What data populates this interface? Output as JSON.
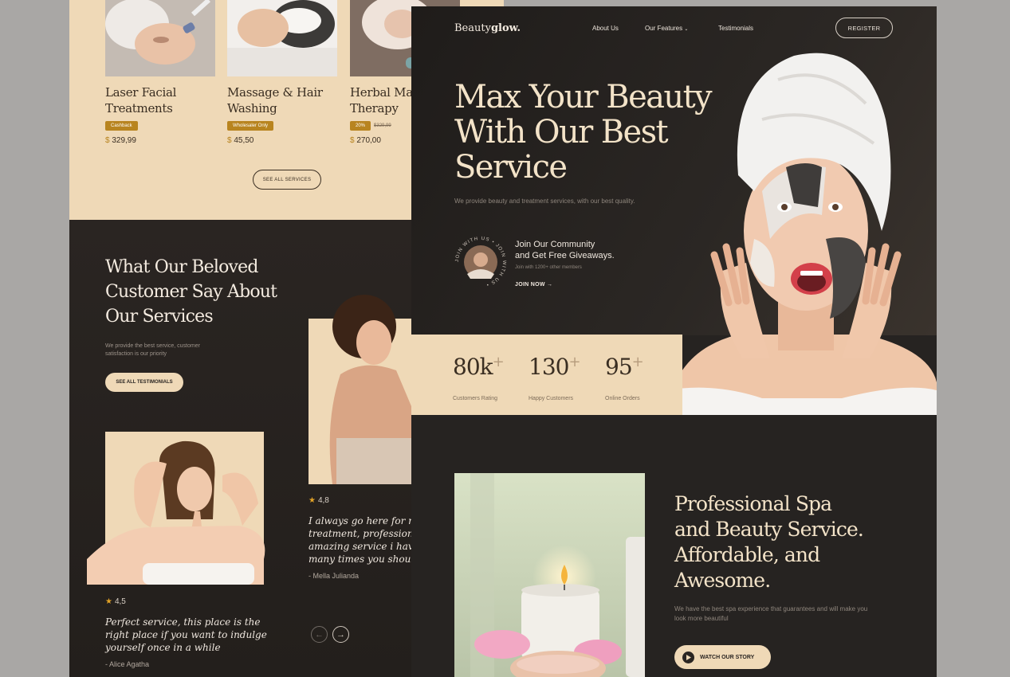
{
  "back": {
    "services": [
      {
        "title": "Laser Facial\nTreatments",
        "badge": "Cashback",
        "old_price": "",
        "currency": "$",
        "price": "329,99"
      },
      {
        "title": "Massage & Hair\nWashing",
        "badge": "Wholesaler Only",
        "old_price": "",
        "currency": "$",
        "price": "45,50"
      },
      {
        "title": "Herbal Mase\nTherapy",
        "badge": "20%",
        "old_price": "$329,99",
        "currency": "$",
        "price": "270,00"
      }
    ],
    "see_all_services": "SEE  ALL SERVICES",
    "testimonials": {
      "heading": "What Our Beloved\nCustomer Say About\nOur Services",
      "sub": "We provide the best service, customer satisfaction is our priority",
      "button": "SEE ALL TESTIMONIALS",
      "reviews": [
        {
          "rating": "4,5",
          "quote": "Perfect service, this place is the\nright place if you want to indulge\nyourself once in a while",
          "author": "- Alice Agatha"
        },
        {
          "rating": "4,8",
          "quote": "I always go here for my\ntreatment, professional a\namazing service i have be\nmany times you should tr",
          "author": "- Mella Julianda"
        }
      ],
      "prev_icon": "arrow-left-icon",
      "next_icon": "arrow-right-icon"
    }
  },
  "front": {
    "logo_regular": "Beauty",
    "logo_bold": "glow.",
    "nav": [
      "About Us",
      "Our Features",
      "Testimonials"
    ],
    "register": "REGISTER",
    "hero_title": "Max Your Beauty\nWith Our Best\nService",
    "hero_sub": "We provide  beauty and treatment services, with our best quality.",
    "community_ring_text": "JOIN WITH US • JOIN WITH US •",
    "community_title": "Join Our Community\nand Get Free Giveaways.",
    "community_sub": "Join with 1200+ other members",
    "join_now": "JOIN NOW",
    "stats": [
      {
        "value": "80k",
        "label": "Customers Rating"
      },
      {
        "value": "130",
        "label": "Happy Customers"
      },
      {
        "value": "95",
        "label": "Online Orders"
      }
    ],
    "spa_title": "Professional Spa\nand Beauty Service.\nAffordable, and\nAwesome.",
    "spa_sub": "We have the best spa experience that guarantees and will make you look more beautiful",
    "watch_story": "WATCH OUR STORY"
  },
  "colors": {
    "cream": "#efd9b7",
    "dark": "#262321",
    "gold": "#b8841f",
    "star": "#e2a226"
  }
}
